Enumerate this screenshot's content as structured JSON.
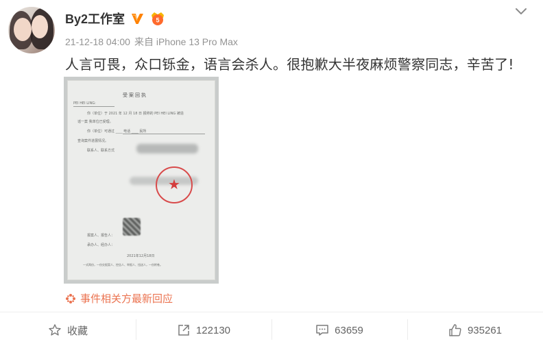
{
  "user": {
    "name": "By2工作室",
    "verified_icon": "verified-v-icon",
    "vip_icon": "vip-badge-icon"
  },
  "meta": {
    "timestamp": "21-12-18 04:00",
    "source": "来自 iPhone 13 Pro Max"
  },
  "post": {
    "text": "人言可畏，众口铄金，语言会杀人。很抱歉大半夜麻烦警察同志，辛苦了!"
  },
  "document_image": {
    "title": "受案回执",
    "name_line": "PEI HEI LING:",
    "line1": "你（单位）于 2021 年 12 月 18 日 报称的 PEI HEI LING 被造",
    "line2": "谣一案 我单位已受理。",
    "line3": "你（单位）可通过 ____ 电话 ____ 民所",
    "line4": "查询案件进展情况。",
    "contact": "联系人、联系方式",
    "reporter": "报案人、报告人：",
    "receiver": "承办人、经办人：",
    "date": "2021年12月18日",
    "footer": "一式两份，一份交报案人、控告人、举报人、扭送人，一份附卷。"
  },
  "related": {
    "icon": "pinwheel-icon",
    "label": "事件相关方最新回应",
    "color": "#eb7350"
  },
  "actions": {
    "favorite": {
      "label": "收藏",
      "icon": "star-icon"
    },
    "repost": {
      "label": "122130",
      "icon": "share-icon"
    },
    "comment": {
      "label": "63659",
      "icon": "comment-icon"
    },
    "like": {
      "label": "935261",
      "icon": "thumbs-up-icon"
    }
  },
  "menu_icon": "chevron-down-icon",
  "colors": {
    "accent": "#eb7350",
    "verified": "#ff8200",
    "meta_text": "#939393"
  }
}
